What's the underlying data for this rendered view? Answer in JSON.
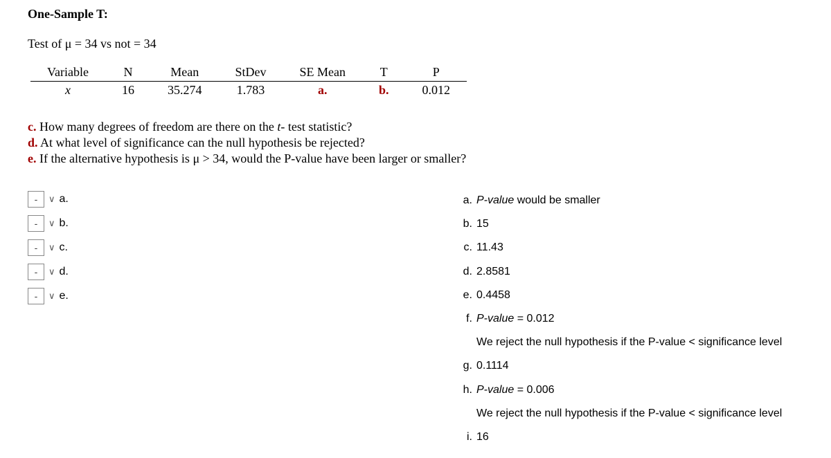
{
  "title": "One-Sample T:",
  "hypothesis": "Test of μ = 34 vs not = 34",
  "headers": {
    "variable": "Variable",
    "n": "N",
    "mean": "Mean",
    "stdev": "StDev",
    "semean": "SE Mean",
    "t": "T",
    "p": "P"
  },
  "row": {
    "variable": "x",
    "n": "16",
    "mean": "35.274",
    "stdev": "1.783",
    "semean": "a.",
    "t": "b.",
    "p": "0.012"
  },
  "questions": {
    "c_prefix": "c.",
    "c_text_1": " How many degrees of freedom are there on the ",
    "c_text_t": "t-",
    "c_text_2": " test statistic?",
    "d_prefix": "d.",
    "d_text": " At what level of significance can the null hypothesis be rejected?",
    "e_prefix": "e.",
    "e_text": " If the alternative hypothesis is μ > 34, would the P-value have been larger or smaller?"
  },
  "match_items": [
    {
      "label": "a."
    },
    {
      "label": "b."
    },
    {
      "label": "c."
    },
    {
      "label": "d."
    },
    {
      "label": "e."
    }
  ],
  "select_placeholder": "-",
  "answers": {
    "a": {
      "letter": "a.",
      "italic": "P-value",
      "rest": " would be smaller"
    },
    "b": {
      "letter": "b.",
      "text": "15"
    },
    "c": {
      "letter": "c.",
      "text": "11.43"
    },
    "d": {
      "letter": "d.",
      "text": "2.8581"
    },
    "e": {
      "letter": "e.",
      "text": "0.4458"
    },
    "f": {
      "letter": "f.",
      "italic": "P-value",
      "rest": " = 0.012"
    },
    "f_sub": "We reject the null hypothesis if the P-value < significance level",
    "g": {
      "letter": "g.",
      "text": "0.1114"
    },
    "h": {
      "letter": "h.",
      "italic": "P-value",
      "rest": " = 0.006"
    },
    "h_sub": "We reject the null hypothesis if the P-value < significance level",
    "i": {
      "letter": "i.",
      "text": "16"
    }
  }
}
